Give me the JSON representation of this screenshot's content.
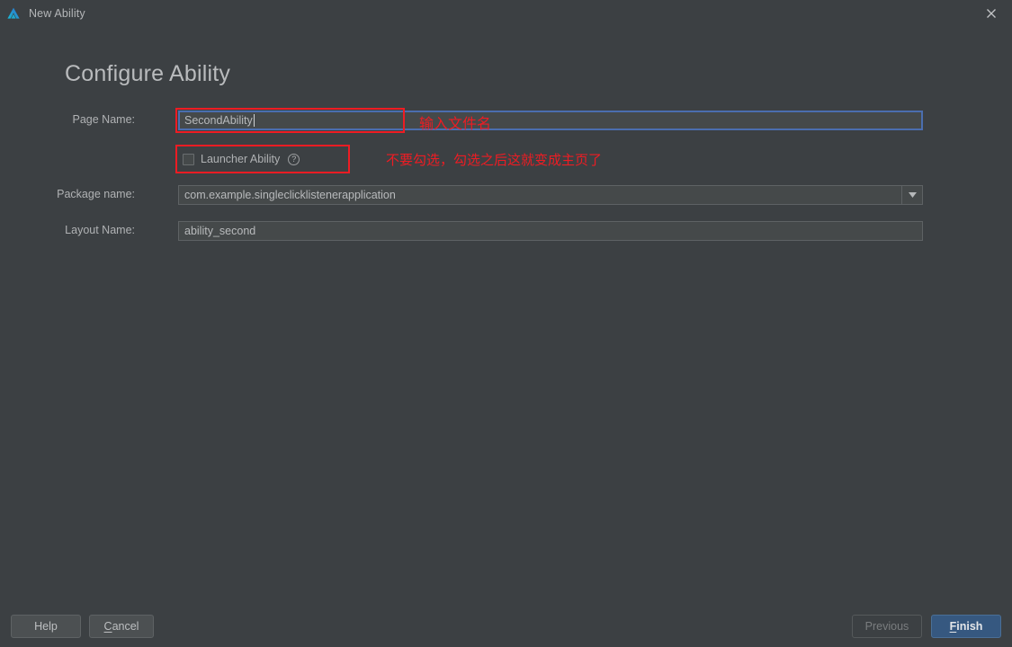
{
  "window": {
    "title": "New Ability",
    "app_icon": "deveco-logo-icon",
    "close_icon": "close-icon"
  },
  "heading": "Configure Ability",
  "form": {
    "page_name": {
      "label": "Page Name:",
      "value": "SecondAbility",
      "placeholder": ""
    },
    "launcher_ability": {
      "label": "Launcher Ability",
      "checked": false,
      "help_icon": "question-mark-icon",
      "help_glyph": "?"
    },
    "package_name": {
      "label": "Package name:",
      "value": "com.example.singleclicklistenerapplication",
      "placeholder": "",
      "dropdown_icon": "chevron-down-icon"
    },
    "layout_name": {
      "label": "Layout Name:",
      "value": "ability_second",
      "placeholder": ""
    }
  },
  "annotations": {
    "page_name_note": "输入文件名",
    "launcher_note": "不要勾选，勾选之后这就变成主页了",
    "color": "#ee1c23"
  },
  "buttons": {
    "help": "Help",
    "cancel_mnemonic": "C",
    "cancel_rest": "ancel",
    "previous": "Previous",
    "finish_mnemonic": "F",
    "finish_rest": "inish"
  },
  "colors": {
    "background": "#3c4043",
    "field_background": "#45494a",
    "focus_border": "#4b6eaf",
    "primary_button": "#365880",
    "annotation_red": "#ee1c23"
  }
}
